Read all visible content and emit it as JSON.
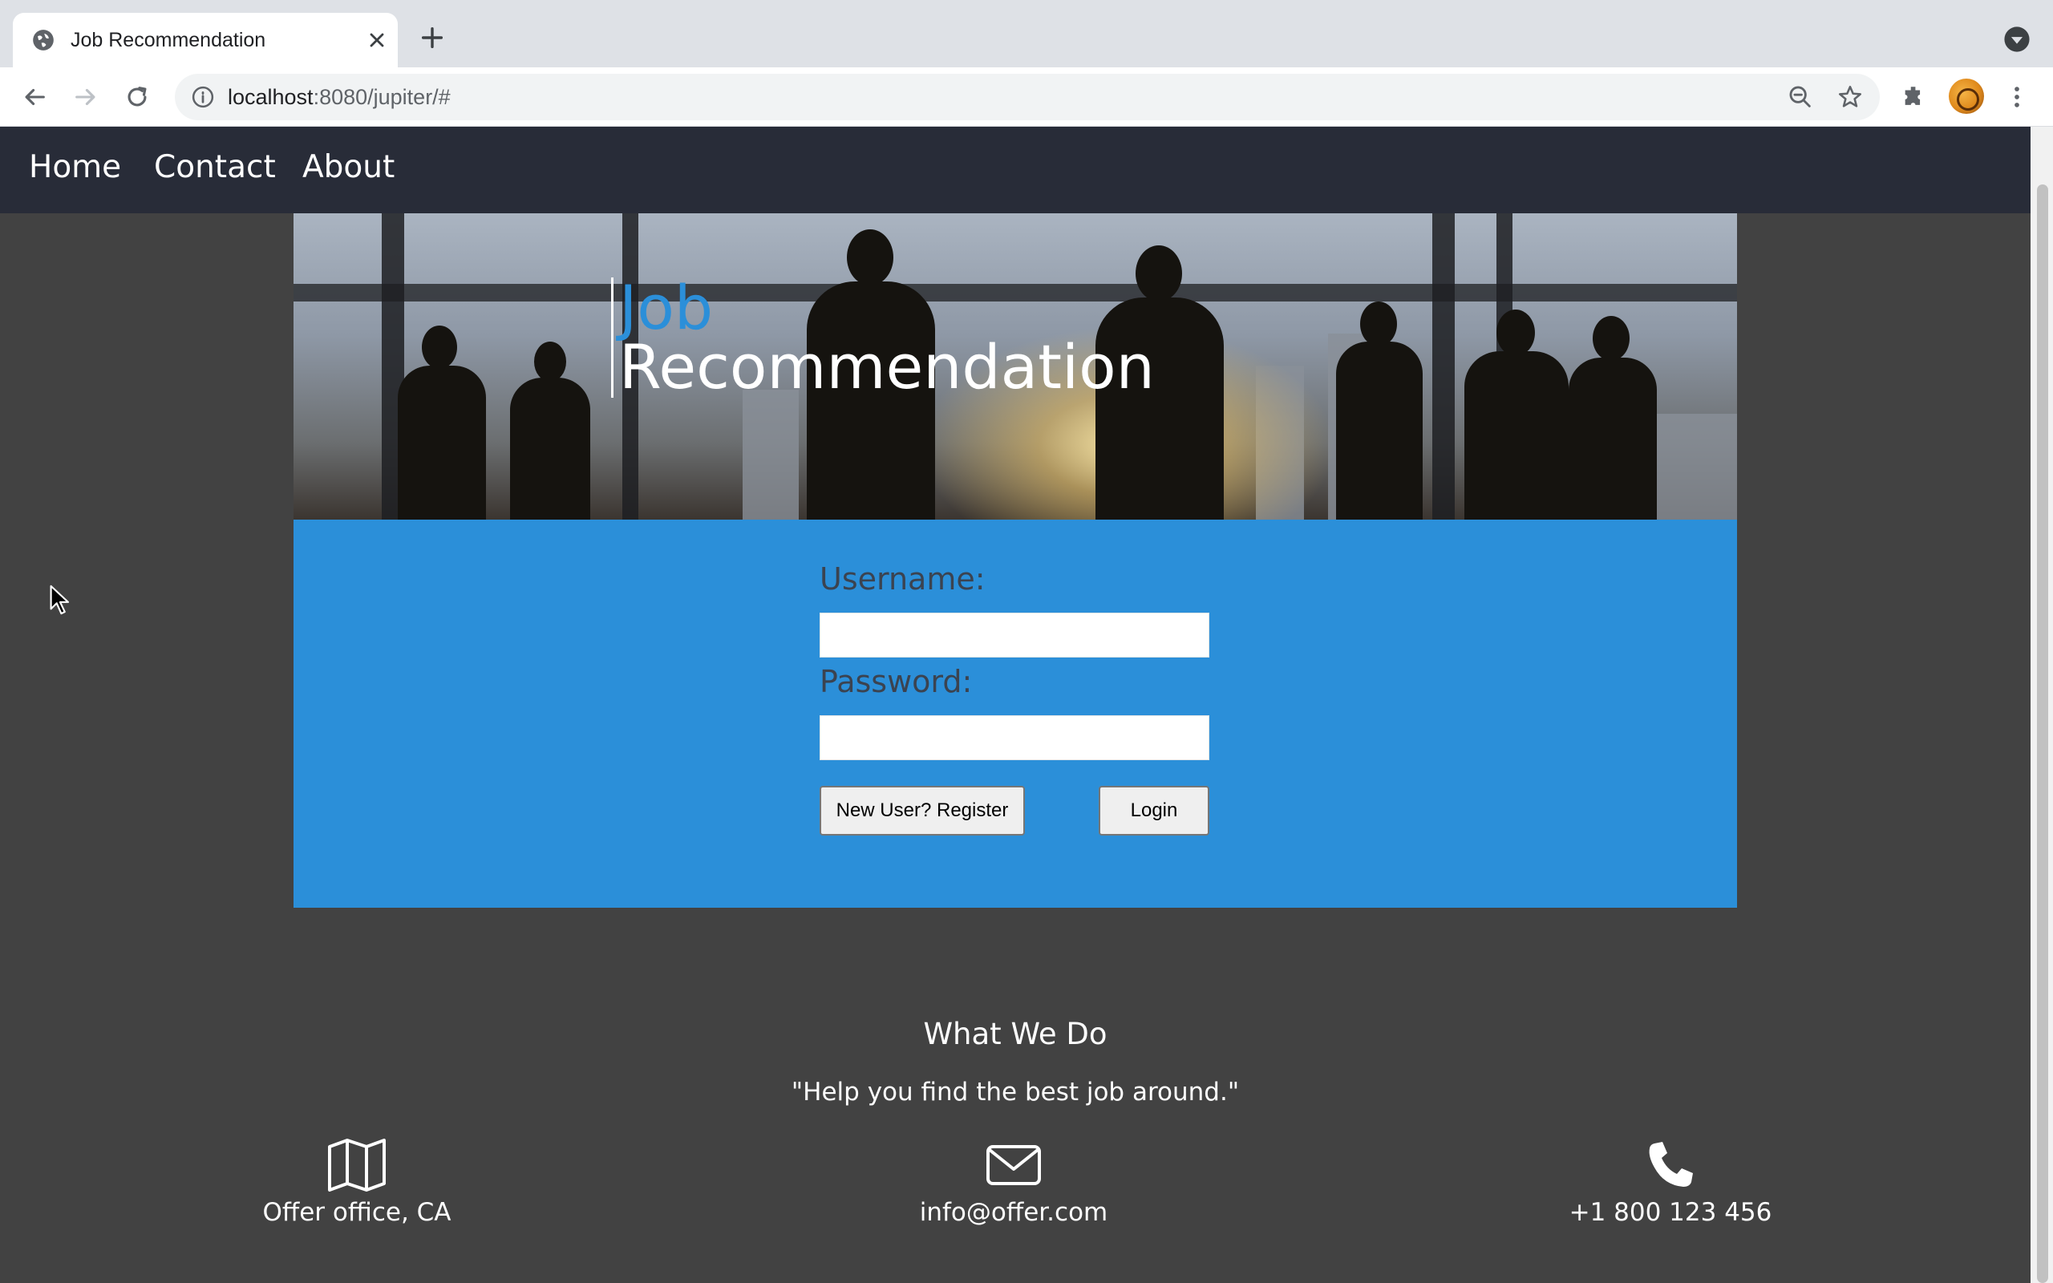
{
  "browser": {
    "tab_title": "Job Recommendation",
    "url_host": "localhost",
    "url_rest": ":8080/jupiter/#"
  },
  "nav": {
    "items": [
      {
        "label": "Home"
      },
      {
        "label": "Contact"
      },
      {
        "label": "About"
      }
    ]
  },
  "hero": {
    "title_line1": "Job",
    "title_line2": "Recommendation"
  },
  "login": {
    "username_label": "Username:",
    "username_value": "",
    "password_label": "Password:",
    "password_value": "",
    "register_button": "New User? Register",
    "login_button": "Login"
  },
  "about": {
    "title": "What We Do",
    "quote": "\"Help you find the best job around.\""
  },
  "contacts": [
    {
      "icon": "map-icon",
      "text": "Offer office, CA"
    },
    {
      "icon": "envelope-icon",
      "text": "info@offer.com"
    },
    {
      "icon": "phone-icon",
      "text": "+1 800 123 456"
    }
  ],
  "colors": {
    "accent": "#2b8fd9",
    "navbar": "#282c38",
    "page_bg": "#424242"
  }
}
